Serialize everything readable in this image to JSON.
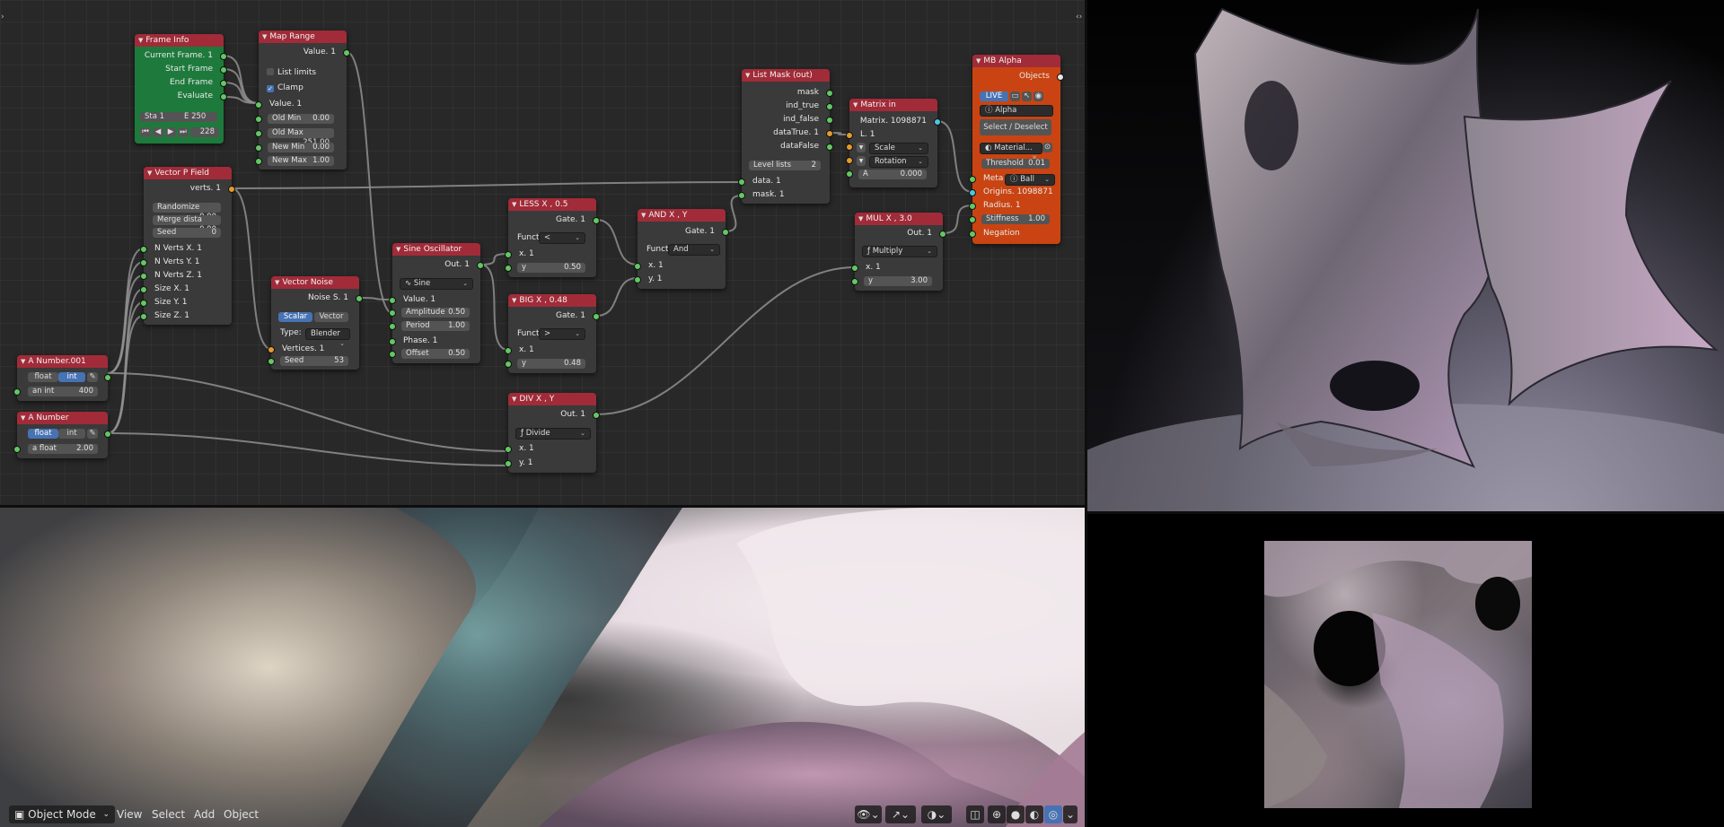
{
  "colors": {
    "node_header_default": "#a12b38",
    "frame_info_body": "#1e7a3c",
    "frame_info_header": "#a12b38",
    "mb_alpha_body": "#c94412",
    "socket_green": "#63c763",
    "socket_orange": "#e39b2e",
    "socket_cyan": "#4bc7e0",
    "selected_blue": "#4772b3"
  },
  "nodes": {
    "frame_info": {
      "title": "Frame Info",
      "outputs": [
        "Current Frame. 1",
        "Start Frame",
        "End Frame",
        "Evaluate"
      ],
      "start": "Sta  1",
      "end": "E  250",
      "frame": "228"
    },
    "map_range": {
      "title": "Map Range",
      "output": "Value. 1",
      "list_limits": "List limits",
      "clamp": "Clamp",
      "input_value": "Value. 1",
      "fields": [
        {
          "label": "Old Min",
          "value": "0.00"
        },
        {
          "label": "Old Max",
          "value": "251.00"
        },
        {
          "label": "New Min",
          "value": "0.00"
        },
        {
          "label": "New Max",
          "value": "1.00"
        }
      ]
    },
    "vector_p_field": {
      "title": "Vector P Field",
      "output": "verts. 1",
      "fields": [
        {
          "label": "Randomize",
          "value": "0.00"
        },
        {
          "label": "Merge dista",
          "value": "0.00"
        },
        {
          "label": "Seed",
          "value": "0"
        }
      ],
      "inputs": [
        "N Verts X. 1",
        "N Verts Y. 1",
        "N Verts Z. 1",
        "Size X. 1",
        "Size Y. 1",
        "Size Z. 1"
      ]
    },
    "vector_noise": {
      "title": "Vector Noise",
      "output": "Noise S. 1",
      "scalar": "Scalar",
      "vector": "Vector",
      "type_label": "Type:",
      "type_value": "Blender",
      "input_vertices": "Vertices. 1",
      "seed_label": "Seed",
      "seed_value": "53"
    },
    "sine_oscillator": {
      "title": "Sine Oscillator",
      "output": "Out. 1",
      "mode": "Sine",
      "input_value": "Value. 1",
      "amplitude_label": "Amplitude",
      "amplitude_value": "0.50",
      "period_label": "Period",
      "period_value": "1.00",
      "phase": "Phase. 1",
      "offset_label": "Offset",
      "offset_value": "0.50"
    },
    "less": {
      "title": "LESS X , 0.5",
      "output": "Gate. 1",
      "func_label": "Functi",
      "func_value": "<",
      "x": "x. 1",
      "y_label": "y",
      "y_value": "0.50"
    },
    "big": {
      "title": "BIG X , 0.48",
      "output": "Gate. 1",
      "func_label": "Functi",
      "func_value": ">",
      "x": "x. 1",
      "y_label": "y",
      "y_value": "0.48"
    },
    "div": {
      "title": "DIV X , Y",
      "output": "Out. 1",
      "op": "Divide",
      "x": "x. 1",
      "y": "y. 1"
    },
    "and": {
      "title": "AND X , Y",
      "output": "Gate. 1",
      "func_label": "Functi",
      "func_value": "And",
      "x": "x. 1",
      "y": "y. 1"
    },
    "list_mask": {
      "title": "List Mask (out)",
      "outputs": [
        "mask",
        "ind_true",
        "ind_false",
        "dataTrue. 1",
        "dataFalse"
      ],
      "level_label": "Level lists",
      "level_value": "2",
      "inputs": [
        "data. 1",
        "mask. 1"
      ]
    },
    "matrix_in": {
      "title": "Matrix in",
      "output": "Matrix. 1098871",
      "input_l": "L. 1",
      "scale": "Scale",
      "rotation": "Rotation",
      "a_label": "A",
      "a_value": "0.000"
    },
    "mul": {
      "title": "MUL X , 3.0",
      "output": "Out. 1",
      "op": "Multiply",
      "x": "x. 1",
      "y_label": "y",
      "y_value": "3.00"
    },
    "mb_alpha": {
      "title": "MB Alpha",
      "objects": "Objects",
      "live": "LIVE",
      "name": "Alpha",
      "select_deselect": "Select / Deselect",
      "material": "Material...",
      "threshold_label": "Threshold",
      "threshold_value": "0.01",
      "meta_label": "Meta",
      "meta_value": "Ball",
      "inputs": [
        "Origins. 1098871",
        "Radius. 1"
      ],
      "stiffness_label": "Stiffness",
      "stiffness_value": "1.00",
      "negation": "Negation"
    },
    "a_number_001": {
      "title": "A Number.001",
      "float": "float",
      "int": "int",
      "field_label": "an int",
      "field_value": "400"
    },
    "a_number": {
      "title": "A Number",
      "float": "float",
      "int": "int",
      "field_label": "a float",
      "field_value": "2.00"
    }
  },
  "header": {
    "mode": "Object Mode",
    "menu": [
      "View",
      "Select",
      "Add",
      "Object"
    ]
  }
}
